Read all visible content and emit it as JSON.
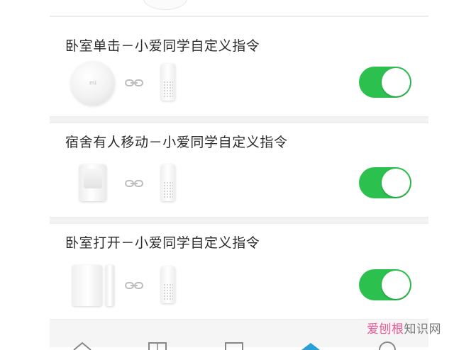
{
  "automations": [
    {
      "title": "卧室单击－小爱同学自定义指令",
      "trigger_device": "wireless-button",
      "trigger_logo": "mi",
      "action_device": "xiaoai-speaker",
      "enabled": true
    },
    {
      "title": "宿舍有人移动－小爱同学自定义指令",
      "trigger_device": "motion-sensor",
      "action_device": "xiaoai-speaker",
      "enabled": true
    },
    {
      "title": "卧室打开－小爱同学自定义指令",
      "trigger_device": "door-window-sensor",
      "action_device": "xiaoai-speaker",
      "enabled": true
    }
  ],
  "colors": {
    "toggle_on": "#2cc04f",
    "divider": "#ececec",
    "watermark_accent": "#ea5a96"
  },
  "watermark": {
    "part1": "爱刨根",
    "part2": "知识网"
  },
  "tab_icons": [
    "home-icon",
    "grid-icon",
    "square-icon",
    "diamond-icon",
    "circle-icon"
  ]
}
